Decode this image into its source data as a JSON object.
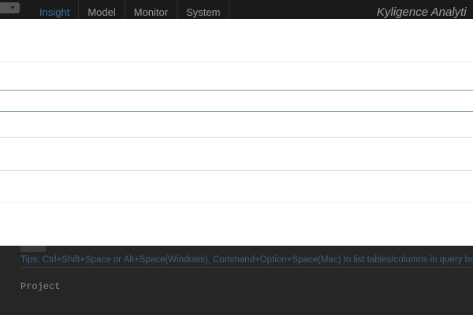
{
  "nav": {
    "tabs": [
      {
        "label": "Insight",
        "active": true
      },
      {
        "label": "Model",
        "active": false
      },
      {
        "label": "Monitor",
        "active": false
      },
      {
        "label": "System",
        "active": false
      }
    ],
    "brand": "Kyligence Analyti"
  },
  "tips": "Tips: Ctrl+Shift+Space or Alt+Space(Windows), Command+Option+Space(Mac) to list tables/columns in query box",
  "project_label": "Project",
  "colors": {
    "nav_background": "#1a1a1a",
    "active_tab": "#3f6ea0",
    "page_background": "#262626",
    "editor_background": "#ffffff",
    "tips_text": "#3e5f7e"
  }
}
